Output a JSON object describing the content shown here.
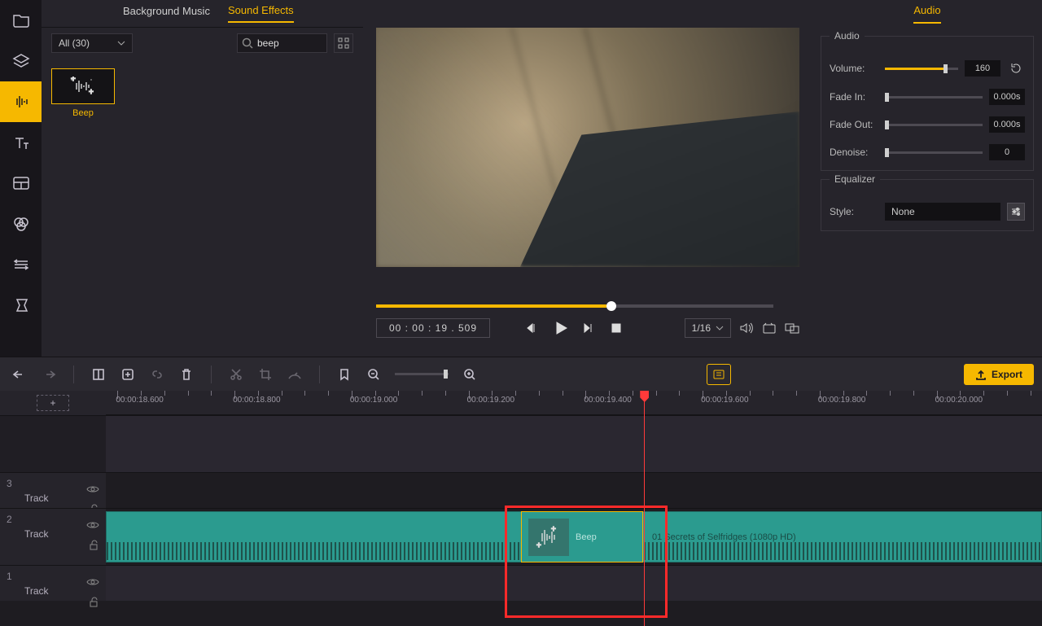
{
  "rail": {
    "active_index": 2
  },
  "lib": {
    "tabs": {
      "bg_music": "Background Music",
      "sfx": "Sound Effects"
    },
    "active_tab": "sfx",
    "category": "All (30)",
    "search_value": "beep",
    "thumb_label": "Beep"
  },
  "preview": {
    "timecode": "00 : 00 : 19 . 509",
    "scrub_pct": 58,
    "ratio": "1/16"
  },
  "props": {
    "tab": "Audio",
    "audio_legend": "Audio",
    "volume_label": "Volume:",
    "volume_value": "160",
    "volume_pct": 80,
    "fadein_label": "Fade In:",
    "fadein_value": "0.000s",
    "fadeout_label": "Fade Out:",
    "fadeout_value": "0.000s",
    "denoise_label": "Denoise:",
    "denoise_value": "0",
    "eq_legend": "Equalizer",
    "eq_style_label": "Style:",
    "eq_style_value": "None"
  },
  "toolbar": {
    "export_label": "Export"
  },
  "timeline": {
    "ruler": [
      "00:00:18.600",
      "00:00:18.800",
      "00:00:19.000",
      "00:00:19.200",
      "00:00:19.400",
      "00:00:19.600",
      "00:00:19.800",
      "00:00:20.000"
    ],
    "playhead_pct": 57.5,
    "tracks": {
      "t3_num": "3",
      "t3_label": "Track",
      "t2_num": "2",
      "t2_label": "Track",
      "t1_num": "1",
      "t1_label": "Track"
    },
    "main_clip_label": "01 Secrets of Selfridges (1080p HD)",
    "short_clip_label": "Beep"
  }
}
